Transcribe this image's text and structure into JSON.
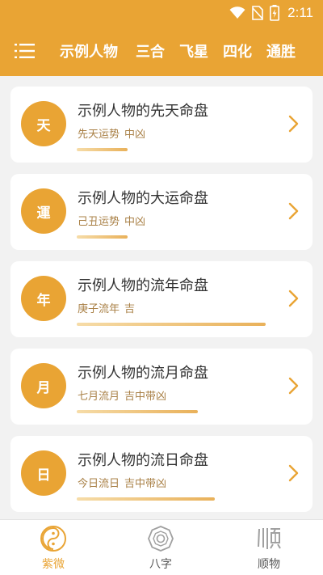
{
  "status_bar": {
    "time": "2:11",
    "icons": [
      "wifi-icon",
      "no-sim-icon",
      "battery-charging-icon"
    ]
  },
  "header": {
    "menu_icon": "menu-list-icon",
    "tabs": [
      {
        "label": "示例人物"
      },
      {
        "label": "三合"
      },
      {
        "label": "飞星"
      },
      {
        "label": "四化"
      },
      {
        "label": "通胜"
      }
    ]
  },
  "cards": [
    {
      "badge": "天",
      "title": "示例人物的先天命盘",
      "sub_a": "先天运势",
      "sub_b": "中凶",
      "progress": 0.27
    },
    {
      "badge": "運",
      "title": "示例人物的大运命盘",
      "sub_a": "己丑运势",
      "sub_b": "中凶",
      "progress": 0.27
    },
    {
      "badge": "年",
      "title": "示例人物的流年命盘",
      "sub_a": "庚子流年",
      "sub_b": "吉",
      "progress": 1.0
    },
    {
      "badge": "月",
      "title": "示例人物的流月命盘",
      "sub_a": "七月流月",
      "sub_b": "吉中带凶",
      "progress": 0.64
    },
    {
      "badge": "日",
      "title": "示例人物的流日命盘",
      "sub_a": "今日流日",
      "sub_b": "吉中带凶",
      "progress": 0.73
    }
  ],
  "bottom_nav": [
    {
      "label": "紫微",
      "icon": "yin-yang-icon",
      "active": true
    },
    {
      "label": "八字",
      "icon": "bagua-icon",
      "active": false
    },
    {
      "label": "顺物",
      "icon": "shun-glyph-icon",
      "active": false
    }
  ],
  "colors": {
    "accent": "#e9a434",
    "subtext": "#a98046",
    "inactive": "#a0a0a0"
  }
}
